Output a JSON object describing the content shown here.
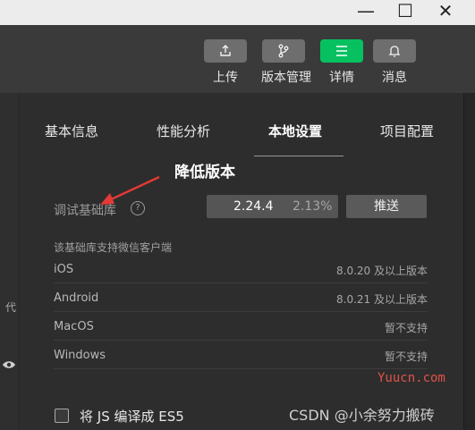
{
  "window": {
    "minimize": "—",
    "maximize": "☐",
    "close": "✕"
  },
  "toolbar": {
    "upload": "上传",
    "version_mgmt": "版本管理",
    "details": "详情",
    "messages": "消息",
    "accent_color": "#07c160"
  },
  "tabs": [
    "基本信息",
    "性能分析",
    "本地设置",
    "项目配置"
  ],
  "active_tab": "本地设置",
  "annotation": "降低版本",
  "base_lib": {
    "label": "调试基础库",
    "version": "2.24.4",
    "percent": "2.13%",
    "push": "推送",
    "support_desc": "该基础库支持微信客户端",
    "platforms": [
      {
        "name": "iOS",
        "value": "8.0.20 及以上版本"
      },
      {
        "name": "Android",
        "value": "8.0.21 及以上版本"
      },
      {
        "name": "MacOS",
        "value": "暂不支持"
      },
      {
        "name": "Windows",
        "value": "暂不支持"
      }
    ]
  },
  "es5_option": "将 JS 编译成 ES5",
  "sidebar": {
    "fragment": "代"
  },
  "watermarks": {
    "yuucn": "Yuucn.com",
    "csdn": "CSDN @小余努力搬砖"
  }
}
